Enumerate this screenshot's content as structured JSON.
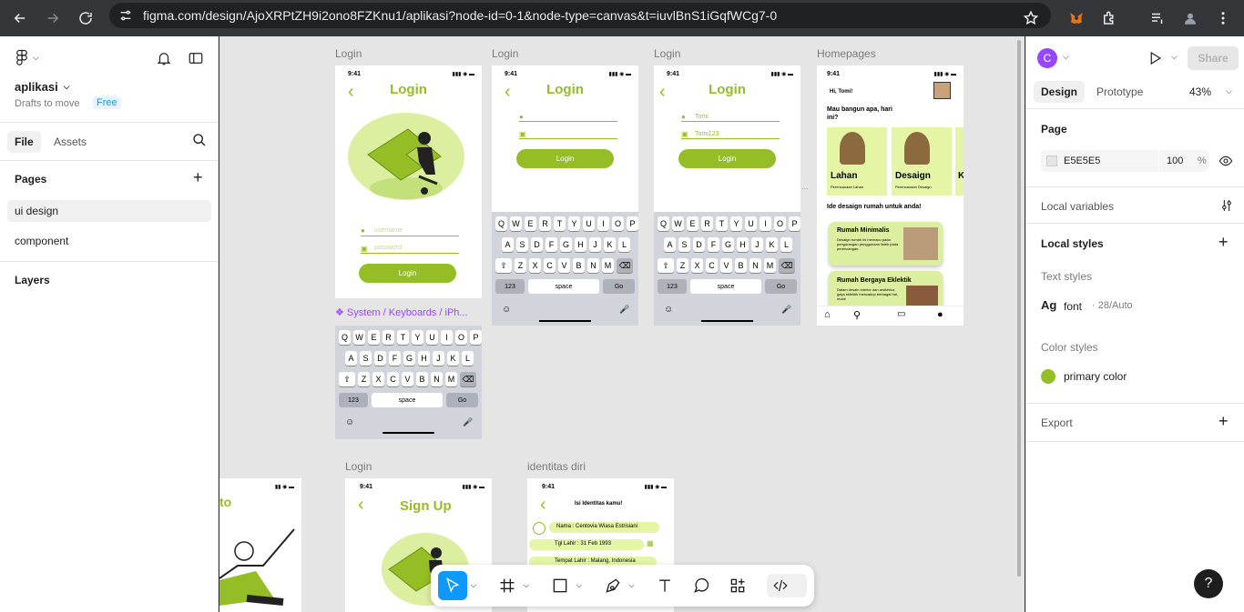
{
  "browser": {
    "url": "figma.com/design/AjoXRPtZH9i2ono8FZKnu1/aplikasi?node-id=0-1&node-type=canvas&t=iuvlBnS1iGqfWCg7-0"
  },
  "left_panel": {
    "file_name": "aplikasi",
    "drafts_text": "Drafts to move",
    "plan_badge": "Free",
    "tabs": [
      "File",
      "Assets"
    ],
    "pages_title": "Pages",
    "pages": [
      "ui design",
      "component"
    ],
    "layers_title": "Layers"
  },
  "canvas": {
    "frames": {
      "login1": {
        "label": "Login",
        "time": "9:41",
        "title": "Login",
        "username": "username",
        "password": "password",
        "button": "Login",
        "component_label": "System / Keyboards / iPh..."
      },
      "login2": {
        "label": "Login",
        "time": "9:41",
        "title": "Login",
        "button": "Login"
      },
      "login3": {
        "label": "Login",
        "time": "9:41",
        "title": "Login",
        "username": "Tomi",
        "password": "Tomi123",
        "button": "Login"
      },
      "home": {
        "label": "Homepages",
        "time": "9:41",
        "greeting": "Hi, Tomi!",
        "question": "Mau bangun apa, hari ini?",
        "cards": [
          {
            "title": "Lahan",
            "subtitle": "Perencanaan Lahan"
          },
          {
            "title": "Desaign",
            "subtitle": "Perencanaan Desaign"
          },
          {
            "title": "K",
            "subtitle": ""
          }
        ],
        "section_title": "Ide desaign rumah untuk anda!",
        "ideas": [
          {
            "title": "Rumah Minimalis",
            "desc": "Desaign rumah ini memacu pada pengurangan penggunaan listrik pada perencangan."
          },
          {
            "title": "Rumah Bergaya Eklektik",
            "desc": "Dalam desain interior dan arsitektur, gaya eklektik mencakup berbagai hal, mulai"
          }
        ]
      },
      "frame_left": {
        "time": "9:41",
        "title_fragment": "to"
      },
      "signup": {
        "label": "Login",
        "time": "9:41",
        "title": "Sign Up"
      },
      "identity": {
        "label": "identitas diri",
        "time": "9:41",
        "title": "Isi Identitas kamu!",
        "fields": [
          "Nama : Centovia Wiasa Estrisiani",
          "Tgl Lahir : 31 Feb 1993",
          "Tempat Lahir : Malang, Indonesia"
        ]
      }
    },
    "keyboard": {
      "row1": [
        "Q",
        "W",
        "E",
        "R",
        "T",
        "Y",
        "U",
        "I",
        "O",
        "P"
      ],
      "row2": [
        "A",
        "S",
        "D",
        "F",
        "G",
        "H",
        "J",
        "K",
        "L"
      ],
      "row3": [
        "Z",
        "X",
        "C",
        "V",
        "B",
        "N",
        "M"
      ],
      "num": "123",
      "space": "space",
      "go": "Go"
    }
  },
  "right_panel": {
    "avatar_letter": "C",
    "share_label": "Share",
    "tabs": [
      "Design",
      "Prototype"
    ],
    "zoom": "43%",
    "page_title": "Page",
    "page_color": "E5E5E5",
    "page_opacity": "100",
    "percent": "%",
    "local_variables": "Local variables",
    "local_styles": "Local styles",
    "text_styles_title": "Text styles",
    "text_style_sample": "Ag",
    "text_style_name": "font",
    "text_style_meta": "28/Auto",
    "color_styles_title": "Color styles",
    "color_style_name": "primary color",
    "export_title": "Export"
  },
  "help_label": "?",
  "colors": {
    "primary": "#94bd26",
    "canvas": "#e5e5e5",
    "figma_blue": "#0d99ff",
    "avatar": "#9747ff"
  }
}
